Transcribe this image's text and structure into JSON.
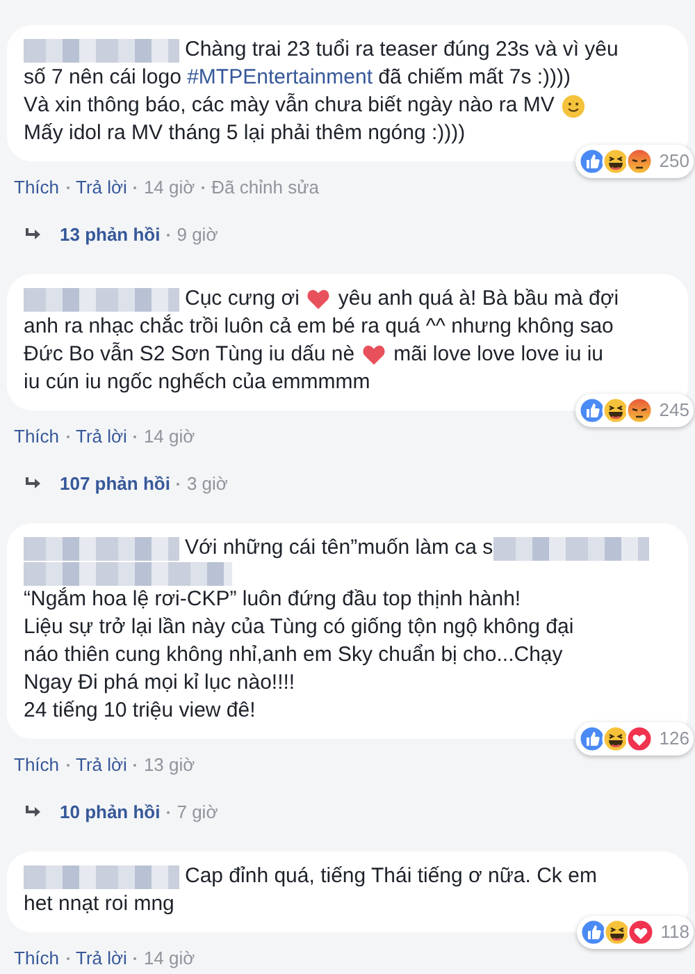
{
  "comments": [
    {
      "lines": [
        [
          {
            "kind": "redacted"
          },
          {
            "kind": "text",
            "text": "Chàng trai 23 tuổi ra teaser đúng 23s và vì yêu"
          }
        ],
        [
          {
            "kind": "text",
            "text": "số 7 nên cái logo "
          },
          {
            "kind": "link",
            "text": "#MTPEntertainment"
          },
          {
            "kind": "text",
            "text": " đã chiếm mất 7s :))))"
          }
        ],
        [
          {
            "kind": "text",
            "text": "Và xin thông báo, các mày vẫn chưa biết ngày nào ra MV"
          },
          {
            "kind": "smile"
          }
        ],
        [
          {
            "kind": "text",
            "text": "Mấy idol ra MV tháng 5 lại phải thêm ngóng :))))"
          }
        ]
      ],
      "reactions": [
        {
          "kind": "like"
        },
        {
          "kind": "haha"
        },
        {
          "kind": "angry"
        }
      ],
      "reaction_count": "250",
      "actions": {
        "like": "Thích",
        "reply": "Trả lời",
        "time": "14 giờ",
        "edited": "Đã chỉnh sửa"
      },
      "replies": {
        "count": "13 phản hồi",
        "time": "9 giờ"
      }
    },
    {
      "lines": [
        [
          {
            "kind": "redacted"
          },
          {
            "kind": "text",
            "text": "Cục cưng ơi"
          },
          {
            "kind": "heart"
          },
          {
            "kind": "text",
            "text": "yêu anh quá à! Bà bầu mà đợi"
          }
        ],
        [
          {
            "kind": "text",
            "text": "anh ra nhạc chắc trồi luôn cả em bé ra quá ^^ nhưng không sao"
          }
        ],
        [
          {
            "kind": "text",
            "text": "Đức Bo vẫn S2 Sơn Tùng iu dấu nè"
          },
          {
            "kind": "heart"
          },
          {
            "kind": "text",
            "text": "mãi love love love iu iu"
          }
        ],
        [
          {
            "kind": "text",
            "text": "iu cún iu ngốc nghếch của emmmmm"
          }
        ]
      ],
      "reactions": [
        {
          "kind": "like"
        },
        {
          "kind": "haha"
        },
        {
          "kind": "angry"
        }
      ],
      "reaction_count": "245",
      "actions": {
        "like": "Thích",
        "reply": "Trả lời",
        "time": "14 giờ"
      },
      "replies": {
        "count": "107 phản hồi",
        "time": "3 giờ"
      }
    },
    {
      "lines": [
        [
          {
            "kind": "redacted"
          },
          {
            "kind": "text",
            "text": "Với những cái tên”muốn làm ca s"
          },
          {
            "kind": "redacted"
          }
        ],
        [
          {
            "kind": "redacted"
          }
        ],
        [
          {
            "kind": "text",
            "text": "“Ngắm hoa lệ rơi-CKP” luôn đứng đầu top thịnh hành!"
          }
        ],
        [
          {
            "kind": "text",
            "text": "Liệu sự trở lại lần này của Tùng có giống tộn ngộ không đại"
          }
        ],
        [
          {
            "kind": "text",
            "text": "náo thiên cung không nhỉ,anh em Sky chuẩn bị cho...Chạy"
          }
        ],
        [
          {
            "kind": "text",
            "text": "Ngay Đi phá mọi kỉ lục nào!!!!"
          }
        ],
        [
          {
            "kind": "text",
            "text": "24 tiếng 10 triệu view đê!"
          }
        ]
      ],
      "reactions": [
        {
          "kind": "like"
        },
        {
          "kind": "haha"
        },
        {
          "kind": "love"
        }
      ],
      "reaction_count": "126",
      "actions": {
        "like": "Thích",
        "reply": "Trả lời",
        "time": "13 giờ"
      },
      "replies": {
        "count": "10 phản hồi",
        "time": "7 giờ"
      }
    },
    {
      "lines": [
        [
          {
            "kind": "redacted"
          },
          {
            "kind": "text",
            "text": "Cap đỉnh quá, tiếng Thái tiếng ơ nữa. Ck em"
          }
        ],
        [
          {
            "kind": "text",
            "text": "het nnạt roi mng"
          }
        ]
      ],
      "reactions": [
        {
          "kind": "like"
        },
        {
          "kind": "haha"
        },
        {
          "kind": "love"
        }
      ],
      "reaction_count": "118",
      "actions": {
        "like": "Thích",
        "reply": "Trả lời",
        "time": "14 giờ"
      }
    }
  ]
}
